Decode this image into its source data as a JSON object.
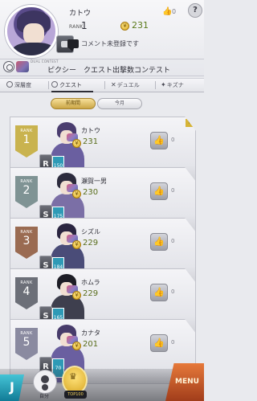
{
  "header": {
    "player_name": "カトウ",
    "rank_label": "RANK",
    "rank_value": "1",
    "points": "231",
    "likes_count": "0",
    "help_label": "?",
    "comment_text": "コメント未登録です",
    "event_small_label": "DUAL CONTEST",
    "event_title": "ピクシー　クエスト出撃数コンテスト"
  },
  "tabs": [
    {
      "label": "深層度",
      "icon": "eye-icon"
    },
    {
      "label": "クエスト",
      "icon": "target-icon",
      "active": true
    },
    {
      "label": "デュエル",
      "icon": "crossed-swords-icon"
    },
    {
      "label": "キズナ",
      "icon": "star-icon"
    }
  ],
  "period": {
    "first_label": "前期間",
    "second_label": "今月"
  },
  "colors": {
    "rank1": "#c9b34f",
    "rank2": "#7f9394",
    "rank3": "#9a6b52",
    "rank4": "#6c6f78",
    "rank5": "#8a8aa0",
    "accent_gold": "#d7a623",
    "menu_orange": "#d1602d",
    "back_cyan": "#2aa4bd"
  },
  "rows": [
    {
      "rank_label": "RANK",
      "rank": "1",
      "name": "カトウ",
      "points": "231",
      "likes": "0",
      "level": "150",
      "card": "R",
      "hair": "#4a3d6f",
      "body": "#6a5fa0",
      "tag_color": "#c9b34f",
      "badge_color": "#2e9ab6",
      "flag": "TOP"
    },
    {
      "rank_label": "RANK",
      "rank": "2",
      "name": "瀬賀一男",
      "points": "230",
      "likes": "0",
      "level": "175",
      "card": "S",
      "hair": "#2c2b3d",
      "body": "#7b6fa6",
      "tag_color": "#7f9394",
      "badge_color": "#2e9ab6"
    },
    {
      "rank_label": "RANK",
      "rank": "3",
      "name": "シズル",
      "points": "229",
      "likes": "0",
      "level": "184",
      "card": "S",
      "hair": "#2a2540",
      "body": "#4a4c78",
      "tag_color": "#9a6b52",
      "badge_color": "#2e9ab6"
    },
    {
      "rank_label": "RANK",
      "rank": "4",
      "name": "ホムラ",
      "points": "229",
      "likes": "0",
      "level": "165",
      "card": "S",
      "hair": "#1d1d26",
      "body": "#3e3f4e",
      "tag_color": "#6c6f78",
      "badge_color": "#2e9ab6"
    },
    {
      "rank_label": "RANK",
      "rank": "5",
      "name": "カナタ",
      "points": "201",
      "likes": "0",
      "level": "70",
      "card": "R",
      "hair": "#473b6a",
      "body": "#6a5fa0",
      "tag_color": "#8a8aa0",
      "badge_color": "#2e9ab6"
    }
  ],
  "bottom": {
    "back_label": "J",
    "self_label": "自分",
    "top100_label": "TOP100",
    "menu_label": "MENU"
  }
}
